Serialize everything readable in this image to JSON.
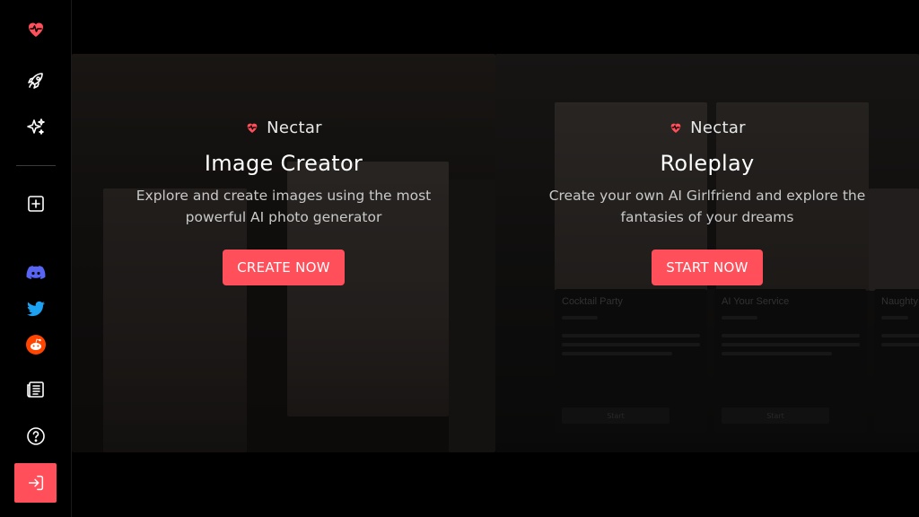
{
  "sidebar": {
    "logo_icon": "heart-pulse-icon",
    "items": [
      {
        "name": "rocket-icon"
      },
      {
        "name": "sparkles-icon"
      },
      {
        "name": "add-square-icon"
      },
      {
        "name": "discord-icon"
      },
      {
        "name": "twitter-icon"
      },
      {
        "name": "reddit-icon"
      },
      {
        "name": "blog-icon"
      },
      {
        "name": "help-icon"
      }
    ],
    "login_icon": "login-icon"
  },
  "cards": [
    {
      "brand": "Nectar",
      "title": "Image Creator",
      "description": "Explore and create images using the most powerful AI photo generator",
      "button": "CREATE NOW"
    },
    {
      "brand": "Nectar",
      "title": "Roleplay",
      "description": "Create your own AI Girlfriend and explore the fantasies of your dreams",
      "button": "START NOW",
      "preview_cards": [
        {
          "title": "Cocktail Party",
          "start": "Start"
        },
        {
          "title": "AI Your Service",
          "start": "Start"
        },
        {
          "title": "Naughty",
          "start": ""
        }
      ]
    }
  ],
  "colors": {
    "accent": "#ff4f5a",
    "background": "#000000",
    "discord": "#5865F2",
    "twitter": "#1DA1F2",
    "reddit": "#FF4500"
  }
}
